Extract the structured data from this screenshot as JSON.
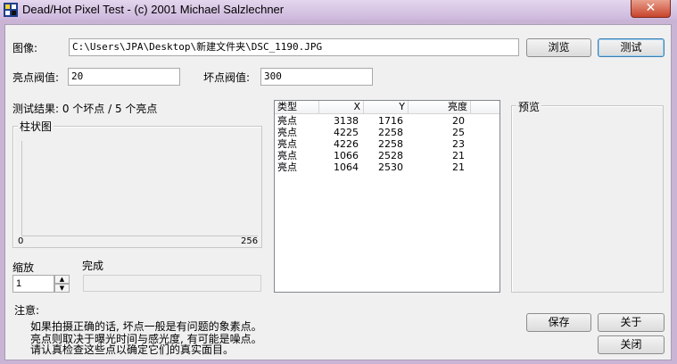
{
  "window": {
    "title": "Dead/Hot Pixel Test - (c) 2001 Michael Salzlechner",
    "close_glyph": "✕"
  },
  "image_row": {
    "label": "图像:",
    "path": "C:\\Users\\JPA\\Desktop\\新建文件夹\\DSC_1190.JPG",
    "browse_label": "浏览",
    "test_label": "测试"
  },
  "thresholds": {
    "hot_label": "亮点阀值:",
    "hot_value": "20",
    "dead_label": "坏点阀值:",
    "dead_value": "300"
  },
  "result": {
    "text": "测试结果: 0 个坏点 / 5 个亮点"
  },
  "histogram": {
    "title": "柱状图",
    "min_label": "0",
    "max_label": "256"
  },
  "zoom": {
    "label": "缩放",
    "value": "1"
  },
  "progress": {
    "label": "完成",
    "value": 0
  },
  "table": {
    "columns": [
      "类型",
      "X",
      "Y",
      "亮度"
    ],
    "rows": [
      {
        "type": "亮点",
        "x": "3138",
        "y": "1716",
        "brightness": "20"
      },
      {
        "type": "亮点",
        "x": "4225",
        "y": "2258",
        "brightness": "25"
      },
      {
        "type": "亮点",
        "x": "4226",
        "y": "2258",
        "brightness": "23"
      },
      {
        "type": "亮点",
        "x": "1066",
        "y": "2528",
        "brightness": "21"
      },
      {
        "type": "亮点",
        "x": "1064",
        "y": "2530",
        "brightness": "21"
      }
    ]
  },
  "preview": {
    "title": "预览"
  },
  "notes": {
    "label": "注意:",
    "line1": "如果拍摄正确的话, 坏点一般是有问题的象素点。",
    "line2": "亮点则取决于曝光时间与感光度, 有可能是噪点。",
    "line3": "请认真检查这些点以确定它们的真实面目。"
  },
  "buttons": {
    "save_label": "保存",
    "about_label": "关于",
    "close_label": "关闭"
  },
  "colors": {
    "titlebar": "#cdb8dc",
    "close": "#c8442b",
    "dialog_bg": "#f0f0f0",
    "default_button_border": "#3c7fb1"
  },
  "icons": {
    "app": "app-pixel-icon",
    "close": "close-icon",
    "spin_up": "spin-up-icon",
    "spin_down": "spin-down-icon"
  }
}
